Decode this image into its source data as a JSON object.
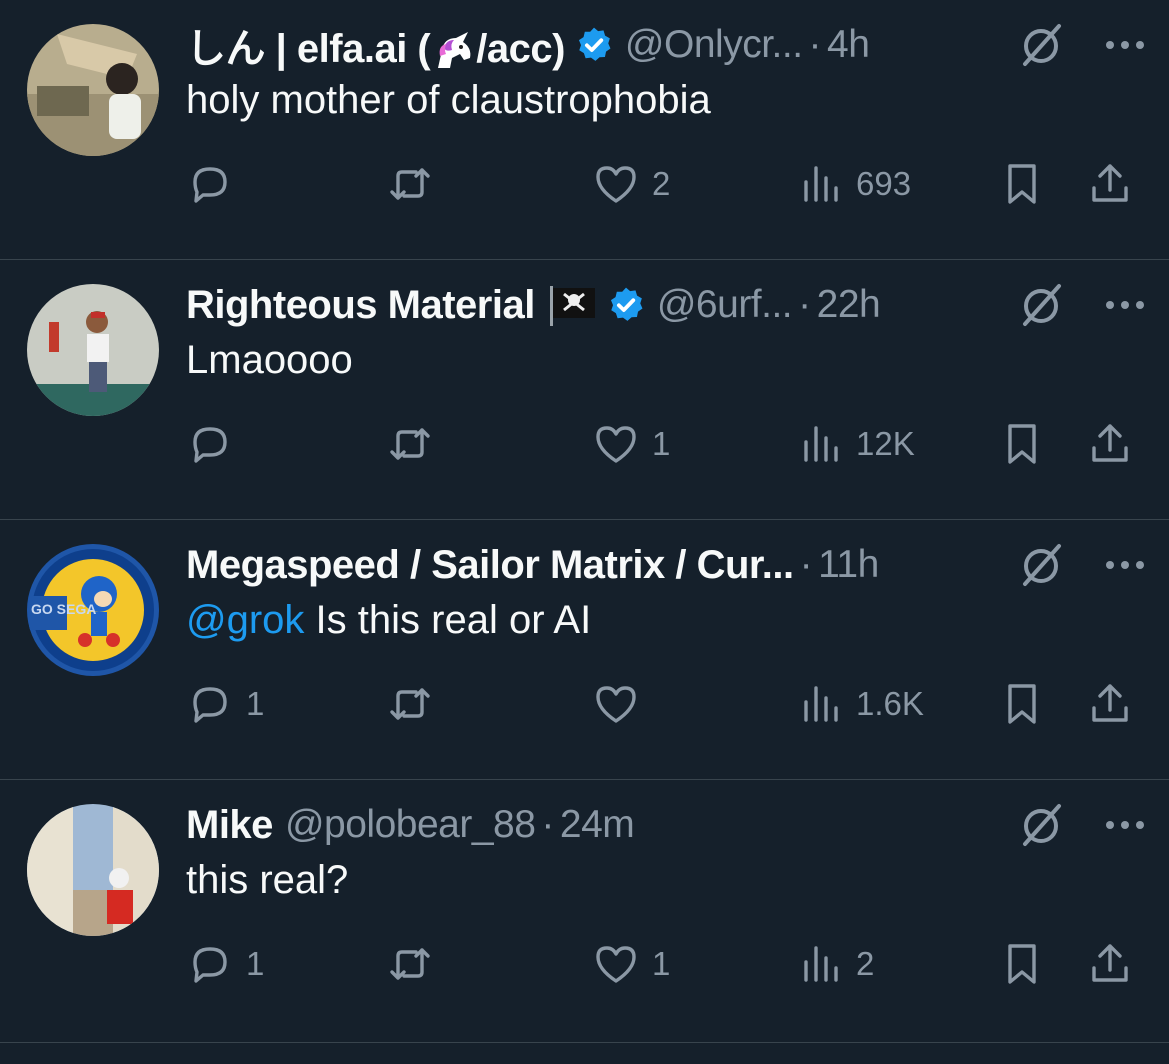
{
  "tweets": [
    {
      "name_prefix": "しん | elfa.ai (",
      "name_suffix": "/acc)",
      "handle": "@Onlycr...",
      "dot": "·",
      "time": "4h",
      "text": "holy mother of claustrophobia",
      "mention": "",
      "counts": {
        "replies": "",
        "likes": "2",
        "views": "693"
      },
      "verified": true
    },
    {
      "name": "Righteous Material",
      "handle": "@6urf...",
      "dot": "·",
      "time": "22h",
      "text": "Lmaoooo",
      "mention": "",
      "counts": {
        "replies": "",
        "likes": "1",
        "views": "12K"
      },
      "verified": true
    },
    {
      "name": "Megaspeed / Sailor Matrix / Cur...",
      "dot": "·",
      "time": "11h",
      "mention": "@grok",
      "text": "Is this real or AI",
      "counts": {
        "replies": "1",
        "likes": "",
        "views": "1.6K"
      },
      "verified": false,
      "avatar_text": "GO SEGA"
    },
    {
      "name": "Mike",
      "handle": "@polobear_88",
      "dot": "·",
      "time": "24m",
      "text": "this real?",
      "mention": "",
      "counts": {
        "replies": "1",
        "likes": "1",
        "views": "2"
      },
      "verified": false
    }
  ],
  "colors": {
    "background": "#15202b",
    "text": "#f7f9f9",
    "muted": "#8b98a5",
    "accent": "#1d9bf0",
    "divider": "#38444d"
  },
  "icons": [
    "reply-icon",
    "retweet-icon",
    "like-icon",
    "views-icon",
    "bookmark-icon",
    "share-icon",
    "grok-icon",
    "more-icon",
    "verified-icon"
  ]
}
